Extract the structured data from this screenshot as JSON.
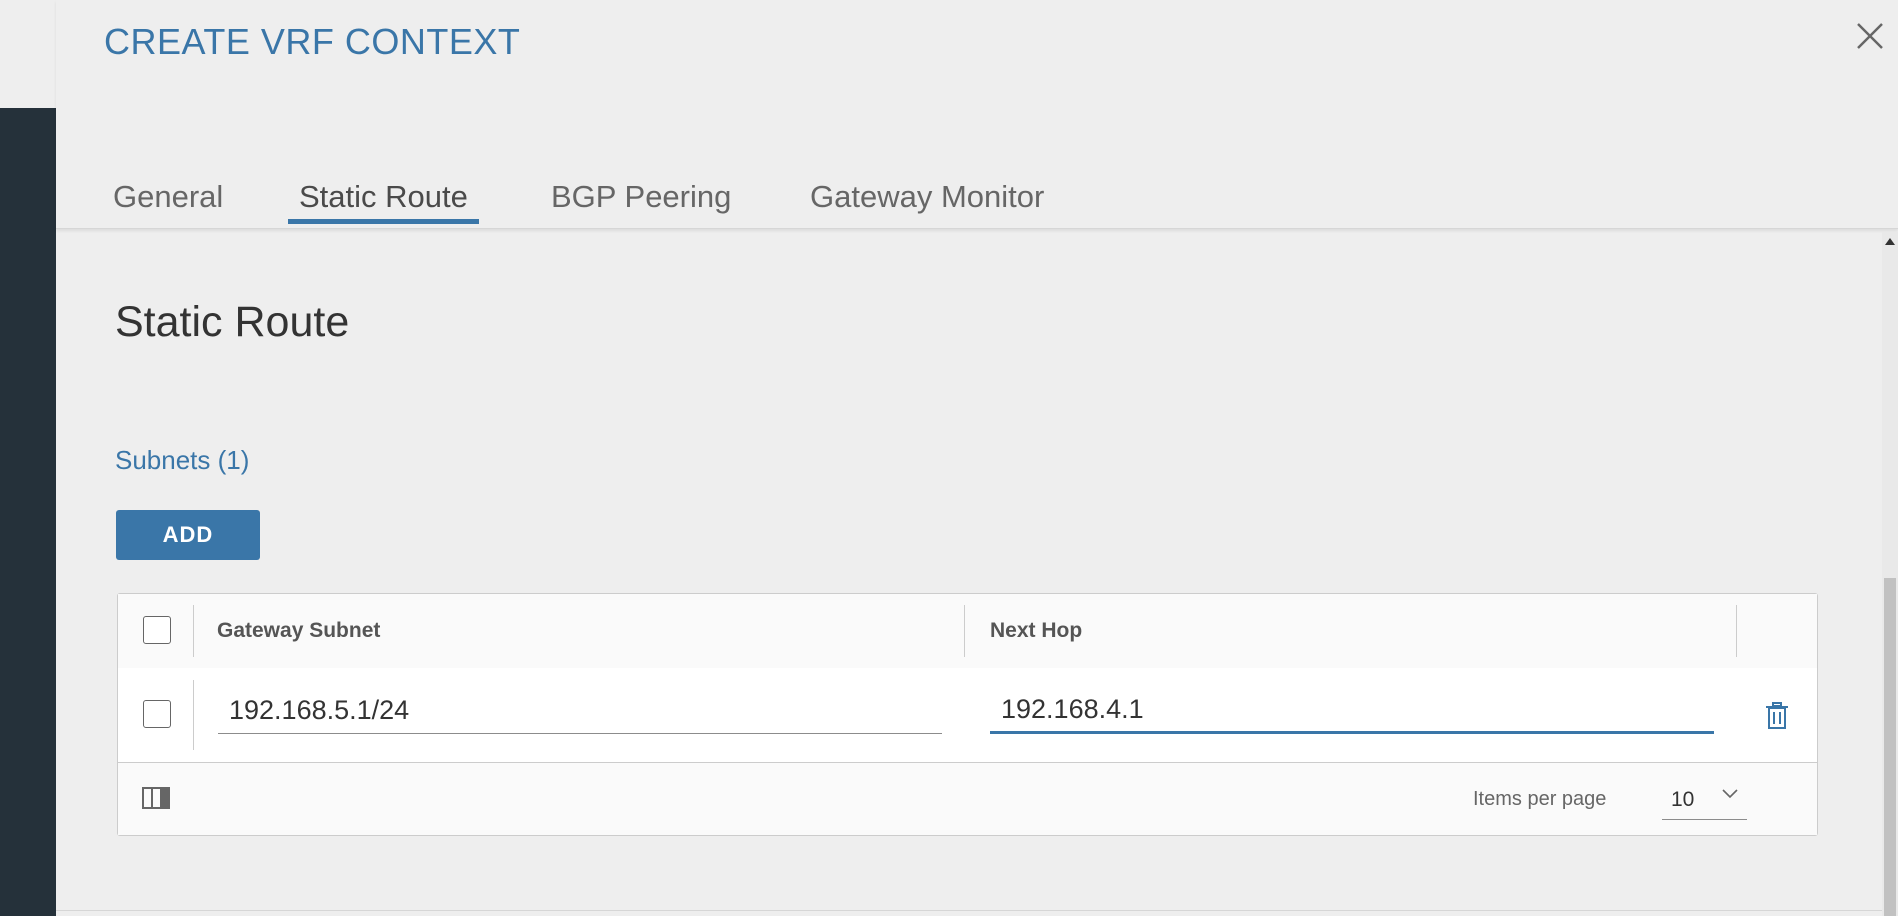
{
  "modal": {
    "title": "CREATE VRF CONTEXT"
  },
  "tabs": [
    {
      "label": "General",
      "active": false
    },
    {
      "label": "Static Route",
      "active": true
    },
    {
      "label": "BGP Peering",
      "active": false
    },
    {
      "label": "Gateway Monitor",
      "active": false
    }
  ],
  "section": {
    "title": "Static Route",
    "subnets_label": "Subnets (1)",
    "add_label": "ADD"
  },
  "grid": {
    "columns": [
      "Gateway Subnet",
      "Next Hop"
    ],
    "rows": [
      {
        "gateway_subnet": "192.168.5.1/24",
        "next_hop": "192.168.4.1"
      }
    ],
    "footer": {
      "items_per_page_label": "Items per page",
      "items_per_page_value": "10"
    }
  },
  "icons": {
    "close": "close-icon",
    "delete": "trash-icon",
    "column_toggle": "column-toggle-icon",
    "dropdown": "chevron-down-icon"
  },
  "colors": {
    "accent": "#3a76a8",
    "sidebar": "#25313a",
    "background": "#eeeeee"
  }
}
